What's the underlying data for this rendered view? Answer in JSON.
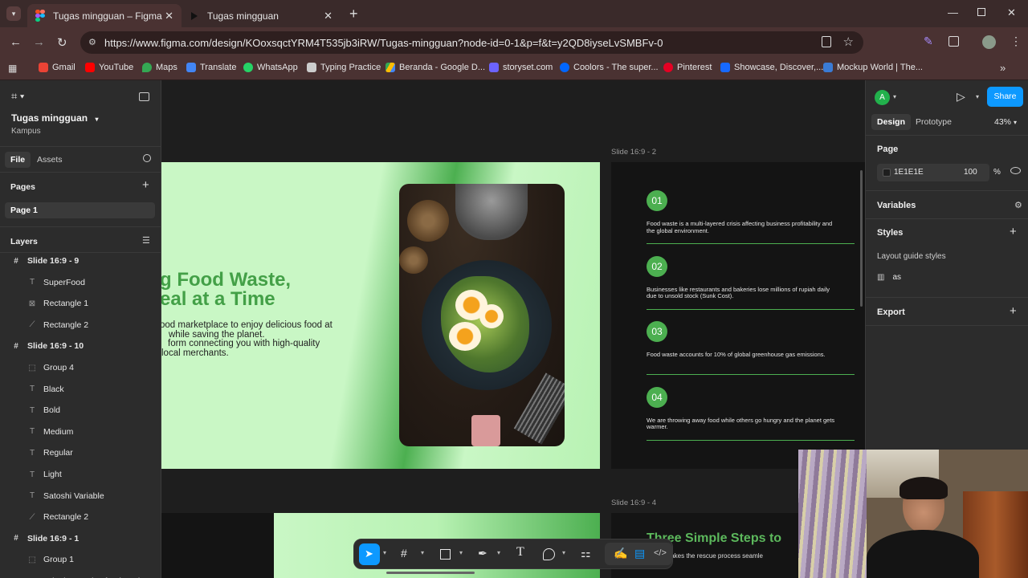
{
  "browser": {
    "tabs": [
      {
        "title": "Tugas mingguan – Figma",
        "active": true
      },
      {
        "title": "Tugas mingguan",
        "active": false
      }
    ],
    "url": "https://www.figma.com/design/KOoxsqctYRM4T535jb3iRW/Tugas-mingguan?node-id=0-1&p=f&t=y2QD8iyseLvSMBFv-0",
    "bookmarks": [
      {
        "label": "Gmail",
        "color": "#ea4335"
      },
      {
        "label": "YouTube",
        "color": "#ff0000"
      },
      {
        "label": "Maps",
        "color": "#34a853"
      },
      {
        "label": "Translate",
        "color": "#4285f4"
      },
      {
        "label": "WhatsApp",
        "color": "#25d366"
      },
      {
        "label": "Typing Practice",
        "color": "#cccccc"
      },
      {
        "label": "Beranda - Google D...",
        "color": "#fbbc04"
      },
      {
        "label": "storyset.com",
        "color": "#6c63ff"
      },
      {
        "label": "Coolors - The super...",
        "color": "#0066ff"
      },
      {
        "label": "Pinterest",
        "color": "#e60023"
      },
      {
        "label": "Showcase, Discover,...",
        "color": "#1769ff"
      },
      {
        "label": "Mockup World | The...",
        "color": "#3a7bd5"
      }
    ]
  },
  "file": {
    "name": "Tugas mingguan",
    "project": "Kampus"
  },
  "leftpanel": {
    "tabs": [
      "File",
      "Assets"
    ],
    "pages_title": "Pages",
    "pages": [
      "Page 1"
    ],
    "layers_title": "Layers",
    "layers": [
      {
        "name": "Slide 16:9 - 9",
        "type": "frame",
        "indent": 0
      },
      {
        "name": "SuperFood",
        "type": "text",
        "indent": 1
      },
      {
        "name": "Rectangle 1",
        "type": "image",
        "indent": 1
      },
      {
        "name": "Rectangle 2",
        "type": "vector",
        "indent": 1
      },
      {
        "name": "Slide 16:9 - 10",
        "type": "frame",
        "indent": 0
      },
      {
        "name": "Group 4",
        "type": "group",
        "indent": 1
      },
      {
        "name": "Black",
        "type": "text",
        "indent": 1
      },
      {
        "name": "Bold",
        "type": "text",
        "indent": 1
      },
      {
        "name": "Medium",
        "type": "text",
        "indent": 1
      },
      {
        "name": "Regular",
        "type": "text",
        "indent": 1
      },
      {
        "name": "Light",
        "type": "text",
        "indent": 1
      },
      {
        "name": "Satoshi Variable",
        "type": "text",
        "indent": 1
      },
      {
        "name": "Rectangle 2",
        "type": "vector",
        "indent": 1
      },
      {
        "name": "Slide 16:9 - 1",
        "type": "frame",
        "indent": 0
      },
      {
        "name": "Group 1",
        "type": "group",
        "indent": 1
      },
      {
        "name": "Join the surplus food market...",
        "type": "text",
        "indent": 1
      }
    ]
  },
  "canvas": {
    "slide_main": {
      "headline_lines": [
        "g Food Waste,",
        "eal at a Time"
      ],
      "body_lines": [
        "ood marketplace to enjoy delicious food at",
        "while saving the planet.",
        "form connecting you with high-quality",
        "local merchants."
      ]
    },
    "slide2": {
      "label": "Slide 16:9 - 2",
      "items": [
        {
          "num": "01",
          "text": "Food waste is a multi-layered crisis affecting business profitability and the global environment."
        },
        {
          "num": "02",
          "text": "Businesses like restaurants and bakeries lose millions of rupiah daily due to unsold stock (Sunk Cost)."
        },
        {
          "num": "03",
          "text": "Food waste accounts for 10% of global greenhouse gas emissions."
        },
        {
          "num": "04",
          "text": "We are throwing away food while others go hungry and the planet gets warmer."
        }
      ]
    },
    "slide4": {
      "label": "Slide 16:9 - 4",
      "title": "Three Simple Steps to",
      "subtitle": "cation makes the rescue process seamle"
    }
  },
  "rightpanel": {
    "avatar_letter": "A",
    "share_label": "Share",
    "tabs": [
      "Design",
      "Prototype"
    ],
    "zoom": "43%",
    "page_title": "Page",
    "page_color": "1E1E1E",
    "page_opacity": "100",
    "percent_sign": "%",
    "variables": "Variables",
    "styles": "Styles",
    "layout_guide_styles": "Layout guide styles",
    "guide_style_name": "as",
    "export": "Export"
  },
  "colors": {
    "accent_green": "#4caf50",
    "slide_bg_green": "#c9f7c5",
    "figma_blue": "#0d99ff"
  }
}
